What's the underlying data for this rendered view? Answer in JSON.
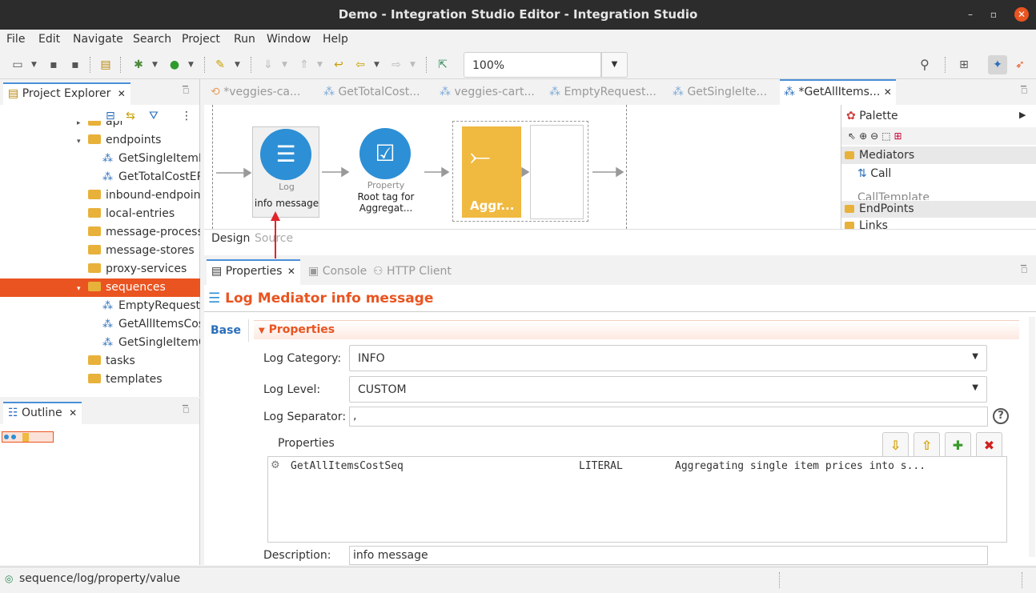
{
  "window": {
    "title": "Demo - Integration Studio Editor - Integration Studio",
    "minimize_glyph": "–",
    "maximize_glyph": "▫",
    "close_glyph": "✕"
  },
  "menu": [
    "File",
    "Edit",
    "Navigate",
    "Search",
    "Project",
    "Run",
    "Window",
    "Help"
  ],
  "toolbar": {
    "zoom": "100%"
  },
  "project_explorer": {
    "title": "Project Explorer",
    "items": [
      {
        "label": "api",
        "type": "folder",
        "depth": 1,
        "arrow": "▸"
      },
      {
        "label": "endpoints",
        "type": "folder",
        "depth": 1,
        "arrow": "▾"
      },
      {
        "label": "GetSingleItemEP",
        "type": "seq",
        "depth": 2
      },
      {
        "label": "GetTotalCostEP",
        "type": "seq",
        "depth": 2
      },
      {
        "label": "inbound-endpoints",
        "type": "folder",
        "depth": 1
      },
      {
        "label": "local-entries",
        "type": "folder",
        "depth": 1
      },
      {
        "label": "message-processors",
        "type": "folder",
        "depth": 1
      },
      {
        "label": "message-stores",
        "type": "folder",
        "depth": 1
      },
      {
        "label": "proxy-services",
        "type": "folder",
        "depth": 1
      },
      {
        "label": "sequences",
        "type": "folder",
        "depth": 1,
        "arrow": "▾",
        "selected": true
      },
      {
        "label": "EmptyRequestSeq",
        "type": "seq",
        "depth": 2
      },
      {
        "label": "GetAllItemsCostSeq",
        "type": "seq",
        "depth": 2
      },
      {
        "label": "GetSingleItemCostSeq",
        "type": "seq",
        "depth": 2
      },
      {
        "label": "tasks",
        "type": "folder",
        "depth": 1
      },
      {
        "label": "templates",
        "type": "folder",
        "depth": 1
      }
    ]
  },
  "outline": {
    "title": "Outline"
  },
  "editor": {
    "tabs": [
      {
        "label": "*veggies-ca...",
        "active": false
      },
      {
        "label": "GetTotalCost...",
        "active": false
      },
      {
        "label": "veggies-cart...",
        "active": false
      },
      {
        "label": "EmptyRequest...",
        "active": false
      },
      {
        "label": "GetSingleIte...",
        "active": false
      },
      {
        "label": "*GetAllItems...",
        "active": true
      }
    ],
    "nodes": {
      "log_type": "Log",
      "log_label": "info message",
      "property_type": "Property",
      "property_label_1": "Root tag for",
      "property_label_2": "Aggregat...",
      "aggregate_label": "Aggr..."
    },
    "design_tab": "Design",
    "source_tab": "Source"
  },
  "palette": {
    "title": "Palette",
    "sections": {
      "mediators": "Mediators",
      "call": "Call",
      "call_template": "CallTemplate",
      "endpoints": "EndPoints",
      "links": "Links"
    }
  },
  "properties_view": {
    "tabs": {
      "properties": "Properties",
      "console": "Console",
      "http_client": "HTTP Client"
    },
    "heading": "Log Mediator info message",
    "side_tab": "Base",
    "section": "Properties",
    "fields": {
      "log_category_label": "Log Category:",
      "log_category": "INFO",
      "log_level_label": "Log Level:",
      "log_level": "CUSTOM",
      "log_separator_label": "Log Separator:",
      "log_separator": ",",
      "properties_label": "Properties",
      "description_label": "Description:",
      "description": "info message"
    },
    "table_rows": [
      {
        "name": "GetAllItemsCostSeq",
        "type": "LITERAL",
        "value": "Aggregating single item prices into s..."
      }
    ]
  },
  "statusbar": {
    "text": "sequence/log/property/value"
  },
  "colors": {
    "accent": "#e95420",
    "mediator_blue": "#2d8fd5",
    "aggregate_yellow": "#f0b940",
    "arrow_red": "#e0242b"
  }
}
